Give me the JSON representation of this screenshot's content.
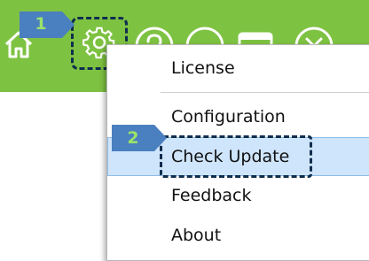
{
  "colors": {
    "toolbar_bg": "#7ec242",
    "icon_stroke": "#ffffff",
    "highlight_bg": "#cfe5fb",
    "focus_border": "#0e2d4e",
    "badge_bg": "#4a7fc0",
    "badge_text": "#9be36a"
  },
  "toolbar": {
    "icons": [
      "home-icon",
      "gear-icon",
      "help-icon",
      "minimize-icon",
      "maximize-icon",
      "close-icon"
    ]
  },
  "steps": {
    "step1": "1",
    "step2": "2"
  },
  "menu": {
    "items": [
      {
        "label": "License"
      },
      {
        "label": "Configuration"
      },
      {
        "label": "Check Update",
        "highlighted": true
      },
      {
        "label": "Feedback"
      },
      {
        "label": "About"
      }
    ]
  }
}
